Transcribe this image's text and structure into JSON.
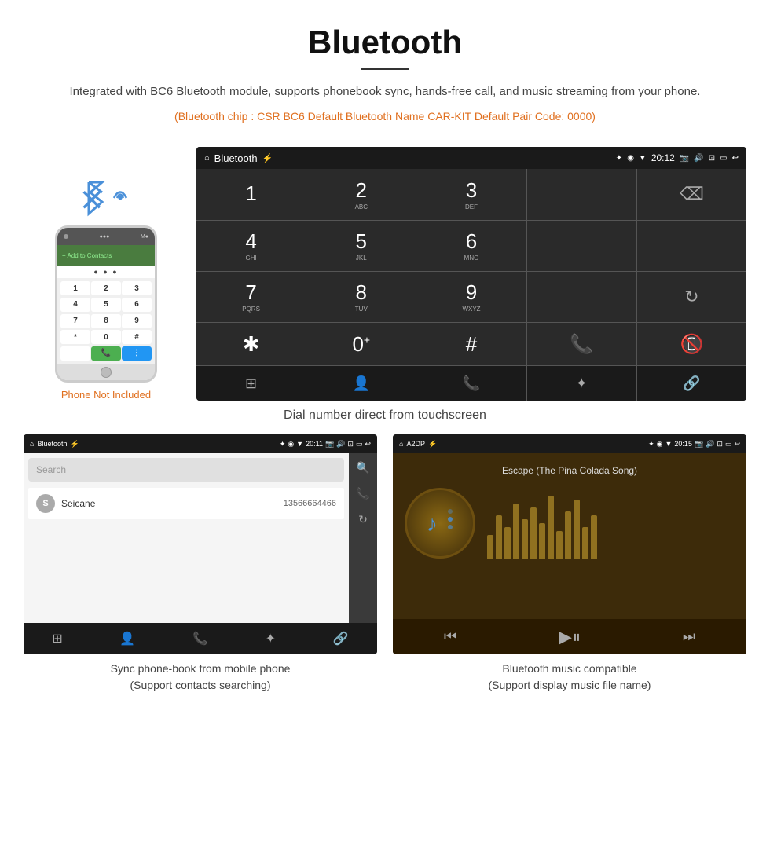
{
  "header": {
    "title": "Bluetooth",
    "description": "Integrated with BC6 Bluetooth module, supports phonebook sync, hands-free call, and music streaming from your phone.",
    "specs": "(Bluetooth chip : CSR BC6    Default Bluetooth Name CAR-KIT    Default Pair Code: 0000)"
  },
  "android_screen": {
    "app_title": "Bluetooth",
    "time": "20:12",
    "dialpad": {
      "keys": [
        {
          "number": "1",
          "letters": ""
        },
        {
          "number": "2",
          "letters": "ABC"
        },
        {
          "number": "3",
          "letters": "DEF"
        },
        {
          "number": "4",
          "letters": "GHI"
        },
        {
          "number": "5",
          "letters": "JKL"
        },
        {
          "number": "6",
          "letters": "MNO"
        },
        {
          "number": "7",
          "letters": "PQRS"
        },
        {
          "number": "8",
          "letters": "TUV"
        },
        {
          "number": "9",
          "letters": "WXYZ"
        },
        {
          "number": "*",
          "letters": ""
        },
        {
          "number": "0+",
          "letters": ""
        },
        {
          "number": "#",
          "letters": ""
        }
      ]
    }
  },
  "phone_section": {
    "not_included": "Phone Not Included"
  },
  "dial_caption": "Dial number direct from touchscreen",
  "bottom_left": {
    "app_title": "Bluetooth",
    "time": "20:11",
    "search_placeholder": "Search",
    "contact": {
      "initial": "S",
      "name": "Seicane",
      "number": "13566664466"
    },
    "caption_line1": "Sync phone-book from mobile phone",
    "caption_line2": "(Support contacts searching)"
  },
  "bottom_right": {
    "app_title": "A2DP",
    "time": "20:15",
    "song_title": "Escape (The Pina Colada Song)",
    "caption_line1": "Bluetooth music compatible",
    "caption_line2": "(Support display music file name)"
  },
  "eq_bars": [
    30,
    55,
    40,
    70,
    50,
    65,
    45,
    80,
    35,
    60,
    75,
    40,
    55
  ]
}
